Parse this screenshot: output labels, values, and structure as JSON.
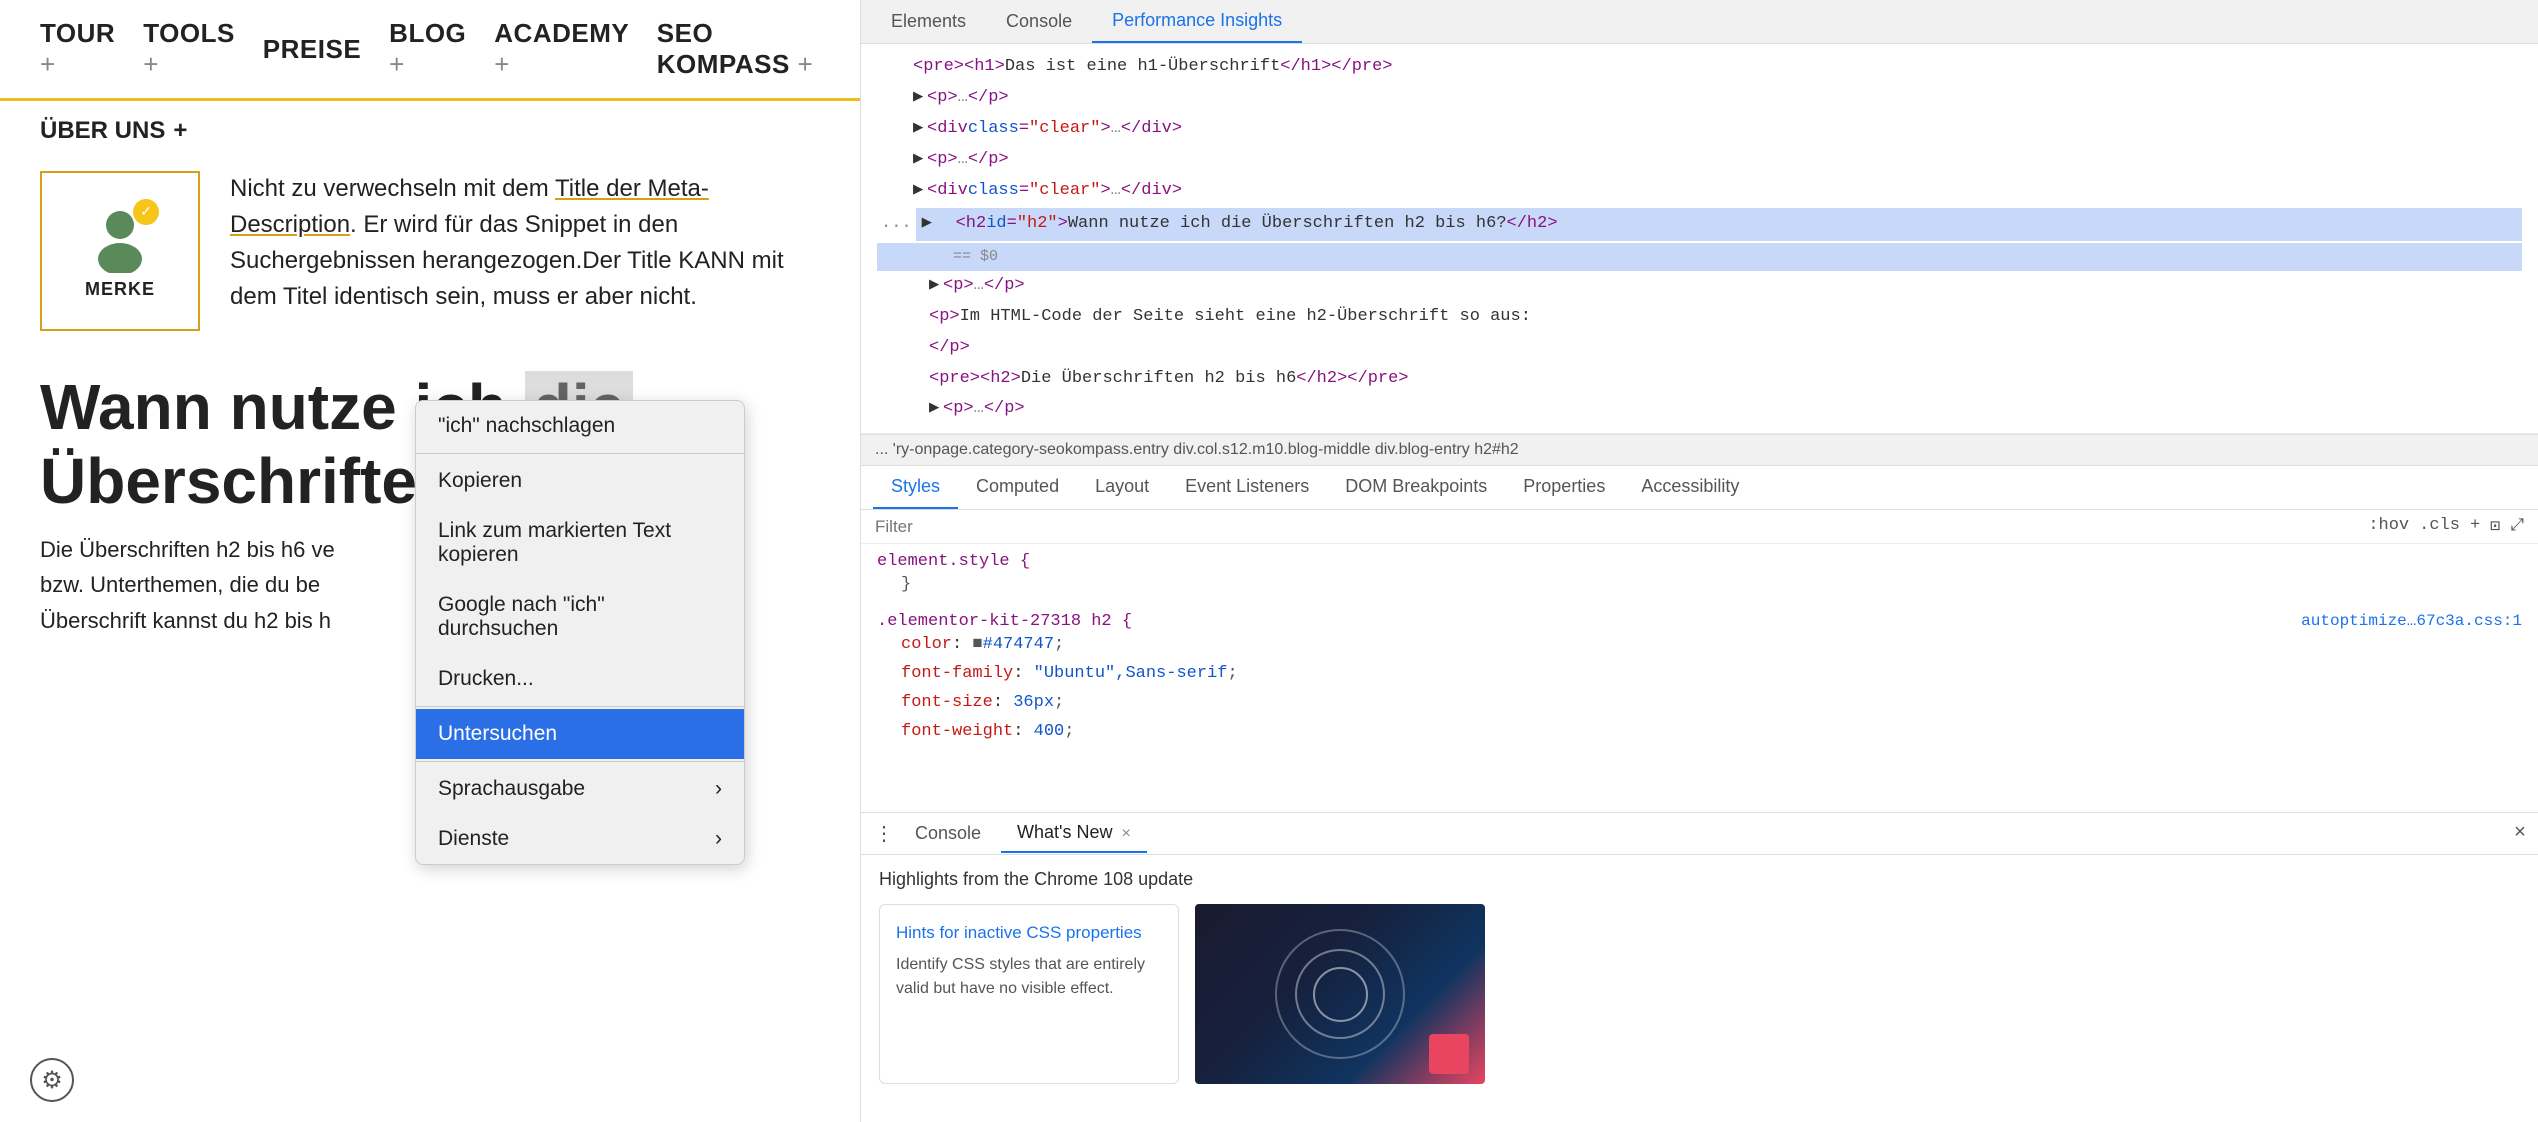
{
  "nav": {
    "items": [
      {
        "label": "TOUR",
        "has_plus": true
      },
      {
        "label": "TOOLS",
        "has_plus": true
      },
      {
        "label": "PREISE",
        "has_plus": false
      },
      {
        "label": "BLOG",
        "has_plus": true
      },
      {
        "label": "ACADEMY",
        "has_plus": true
      },
      {
        "label": "SEO KOMPASS",
        "has_plus": true
      }
    ]
  },
  "uber_uns": {
    "label": "ÜBER UNS",
    "plus": "+"
  },
  "merke": {
    "label": "MERKE",
    "text_before_link": "Nicht zu verwechseln mit dem ",
    "link_text": "Title der Meta-Description",
    "text_after": ". Er wird für das Snippet in den Suchergebnissen herangezogen.Der Title KANN mit dem Titel identisch sein, muss er aber nicht."
  },
  "heading": {
    "line1": "Wann nutze ich die",
    "line2": "Überschriften h",
    "subtext": "Die Überschriften h2 bis h6 ve",
    "subtext2": "bzw. Unterthemen, die du be",
    "subtext3": "Überschrift kannst du h2 bis h"
  },
  "context_menu": {
    "items": [
      {
        "label": "\"ich\" nachschlagen",
        "active": false,
        "has_arrow": false
      },
      {
        "label": "Kopieren",
        "active": false,
        "has_arrow": false
      },
      {
        "label": "Link zum markierten Text kopieren",
        "active": false,
        "has_arrow": false
      },
      {
        "label": "Google nach \"ich\" durchsuchen",
        "active": false,
        "has_arrow": false
      },
      {
        "label": "Drucken...",
        "active": false,
        "has_arrow": false
      },
      {
        "label": "Untersuchen",
        "active": true,
        "has_arrow": false
      },
      {
        "label": "Sprachausgabe",
        "active": false,
        "has_arrow": true
      },
      {
        "label": "Dienste",
        "active": false,
        "has_arrow": true
      }
    ]
  },
  "devtools": {
    "top_tabs": [
      "Elements",
      "Console",
      "Performance Insights"
    ],
    "active_top_tab": "Elements",
    "html_lines": [
      {
        "text": "<pre><h1>Das ist eine h1-Überschrift</h1></pre>",
        "indent": 2,
        "selected": false
      },
      {
        "text": "<p>…</p>",
        "indent": 2,
        "selected": false,
        "collapsible": true
      },
      {
        "text": "<div class=\"clear\">…</div>",
        "indent": 2,
        "selected": false
      },
      {
        "text": "<p>…</p>",
        "indent": 2,
        "selected": false,
        "collapsible": true
      },
      {
        "text": "<div class=\"clear\">…</div>",
        "indent": 2,
        "selected": false
      },
      {
        "text": "<h2 id=\"h2\">Wann nutze ich die Überschriften h2 bis h6?</h2>",
        "indent": 3,
        "selected": true,
        "ellipsis": "..."
      },
      {
        "text": "== $0",
        "indent": 4,
        "selected": true,
        "comment": true
      },
      {
        "text": "<p>…</p>",
        "indent": 3,
        "selected": false,
        "collapsible": true
      },
      {
        "text": "<p>Im HTML-Code der Seite sieht eine h2-Überschrift so aus:",
        "indent": 3,
        "selected": false
      },
      {
        "text": "</p>",
        "indent": 3,
        "selected": false
      },
      {
        "text": "<pre><h2>Die Überschriften h2 bis h6</h2></pre>",
        "indent": 3,
        "selected": false
      },
      {
        "text": "<p>…</p>",
        "indent": 3,
        "selected": false,
        "collapsible": true
      }
    ],
    "breadcrumb": "... 'ry-onpage.category-seokompass.entry   div.col.s12.m10.blog-middle   div.blog-entry   h2#h2",
    "styles_tabs": [
      "Styles",
      "Computed",
      "Layout",
      "Event Listeners",
      "DOM Breakpoints",
      "Properties",
      "Accessibility"
    ],
    "active_styles_tab": "Styles",
    "filter_placeholder": "Filter",
    "filter_buttons": [
      ":hov",
      ".cls",
      "+",
      "⊡",
      "⤢"
    ],
    "element_style": {
      "selector": "element.style {",
      "close": "}"
    },
    "rule": {
      "selector": ".elementor-kit-27318 h2 {",
      "source": "autoptimize…67c3a.css:1",
      "props": [
        {
          "name": "color",
          "value": "■#474747"
        },
        {
          "name": "font-family",
          "value": "\"Ubuntu\",Sans-serif"
        },
        {
          "name": "font-size",
          "value": "36px"
        },
        {
          "name": "font-weight",
          "value": "400"
        }
      ]
    },
    "bottom": {
      "tabs": [
        "Console",
        "What's New"
      ],
      "active_tab": "What's New",
      "whats_new_heading": "Highlights from the Chrome 108 update",
      "card": {
        "link": "Hints for inactive CSS properties",
        "desc": "Identify CSS styles that are entirely valid but have no visible effect."
      }
    }
  }
}
